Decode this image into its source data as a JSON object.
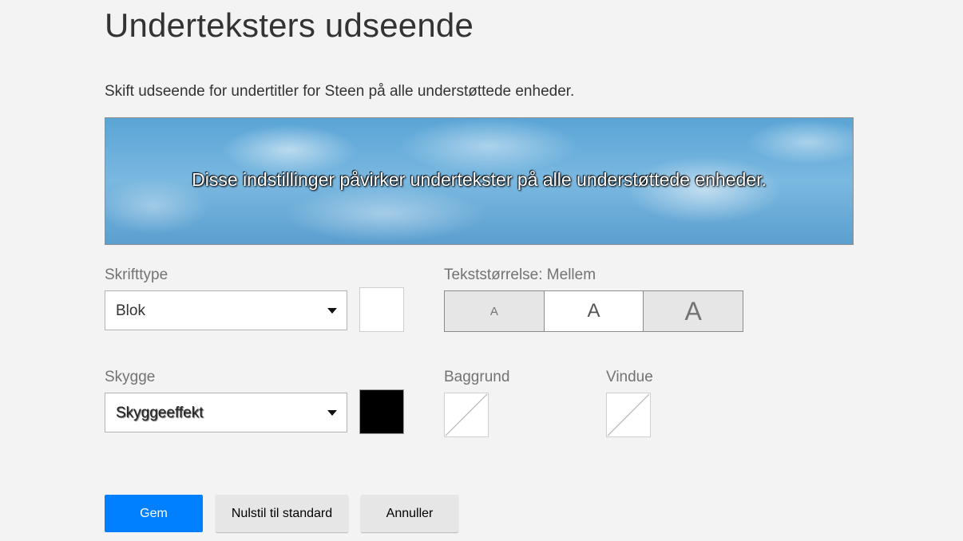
{
  "header": {
    "title": "Underteksters udseende",
    "subtitle": "Skift udseende for undertitler for Steen på alle understøttede enheder."
  },
  "preview": {
    "text": "Disse indstillinger påvirker undertekster på alle understøttede enheder."
  },
  "font": {
    "label": "Skrifttype",
    "value": "Blok",
    "color": "#ffffff"
  },
  "text_size": {
    "label": "Tekststørrelse: Mellem",
    "options": [
      "A",
      "A",
      "A"
    ],
    "selected": "Mellem"
  },
  "shadow": {
    "label": "Skygge",
    "value": "Skyggeeffekt",
    "color": "#000000"
  },
  "background": {
    "label": "Baggrund",
    "color": "none"
  },
  "window": {
    "label": "Vindue",
    "color": "none"
  },
  "actions": {
    "save": "Gem",
    "reset": "Nulstil til standard",
    "cancel": "Annuller"
  }
}
